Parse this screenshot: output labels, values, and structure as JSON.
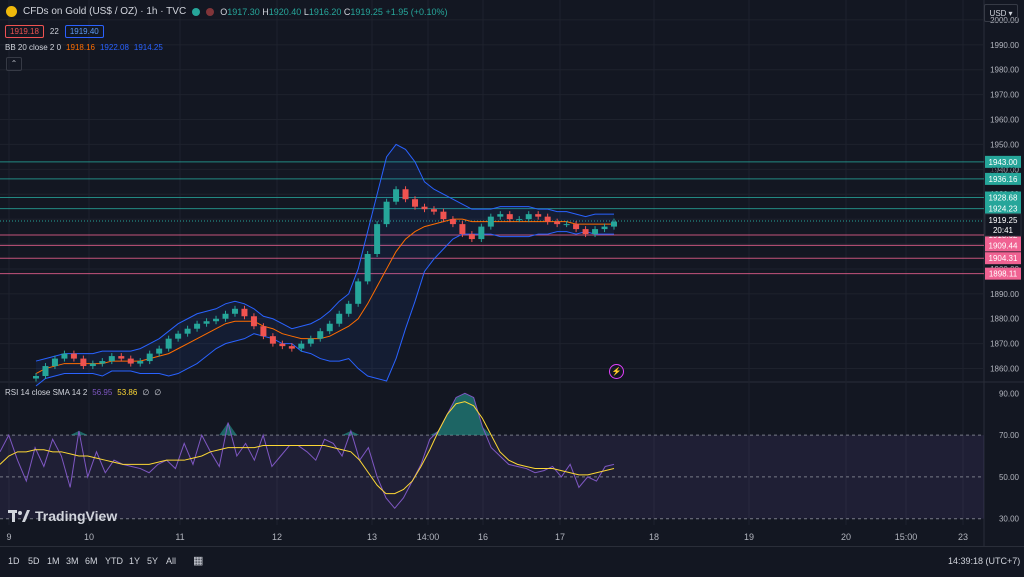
{
  "header": {
    "title": "CFDs on Gold (US$ / OZ) · 1h · TVC",
    "ohlc": {
      "o_label": "O",
      "o": "1917.30",
      "h_label": "H",
      "h": "1920.40",
      "l_label": "L",
      "l": "1916.20",
      "c_label": "C",
      "c": "1919.25",
      "change": "+1.95 (+0.10%)"
    },
    "bid": "1919.18",
    "spread": "22",
    "ask": "1919.40",
    "bb": {
      "label": "BB 20 close 2 0",
      "basis": "1918.16",
      "upper": "1922.08",
      "lower": "1914.25"
    },
    "collapse_icon": "chevron-up-icon"
  },
  "currency": {
    "label": "USD"
  },
  "rsi_legend": {
    "label": "RSI 14 close SMA 14 2",
    "rsi": "56.95",
    "sma": "53.86",
    "e1": "∅",
    "e2": "∅"
  },
  "brand": {
    "name": "TradingView"
  },
  "colors": {
    "bg": "#131722",
    "up": "#26a69a",
    "down": "#ef5350",
    "bb_band": "#2962ff",
    "bb_basis": "#ff6d00",
    "rsi": "#7e57c2",
    "rsi_sma": "#fdd835",
    "green_level": "#26a69a",
    "red_level": "#f06292"
  },
  "toolbar": {
    "timeframes": [
      "1D",
      "5D",
      "1M",
      "3M",
      "6M",
      "YTD",
      "1Y",
      "5Y",
      "All"
    ],
    "calendar_icon": "calendar-icon",
    "clock": "14:39:18 (UTC+7)"
  },
  "chart_data": [
    {
      "type": "candlestick",
      "title": "CFDs on Gold (US$ / OZ)",
      "ylim": [
        1855,
        2008
      ],
      "y_ticks": [
        1860,
        1870,
        1880,
        1890,
        1900,
        1910,
        1920,
        1930,
        1940,
        1950,
        1960,
        1970,
        1980,
        1990,
        2000
      ],
      "x_ticks": [
        "9",
        "10",
        "11",
        "12",
        "13",
        "14:00",
        "16",
        "17",
        "18",
        "19",
        "20",
        "15:00",
        "23"
      ],
      "grid": true,
      "close": [
        1857,
        1861,
        1864,
        1866,
        1864,
        1861,
        1862,
        1863,
        1865,
        1864,
        1862,
        1863,
        1866,
        1868,
        1872,
        1874,
        1876,
        1878,
        1879,
        1880,
        1882,
        1884,
        1881,
        1877,
        1873,
        1870,
        1869,
        1868,
        1870,
        1872,
        1875,
        1878,
        1882,
        1886,
        1895,
        1906,
        1918,
        1927,
        1932,
        1928,
        1925,
        1924,
        1923,
        1920,
        1918,
        1914,
        1912,
        1917,
        1921,
        1922,
        1920,
        1920,
        1922,
        1921,
        1919,
        1918,
        1918,
        1916,
        1914,
        1916,
        1917,
        1919
      ],
      "lines": [
        {
          "name": "BB upper",
          "values": [
            1863,
            1864,
            1865,
            1866,
            1866,
            1866,
            1866,
            1867,
            1867,
            1867,
            1867,
            1868,
            1870,
            1872,
            1875,
            1878,
            1880,
            1882,
            1883,
            1884,
            1886,
            1887,
            1886,
            1884,
            1881,
            1880,
            1878,
            1876,
            1877,
            1878,
            1880,
            1883,
            1887,
            1890,
            1900,
            1915,
            1930,
            1945,
            1950,
            1948,
            1943,
            1935,
            1932,
            1930,
            1928,
            1926,
            1924,
            1924,
            1924,
            1925,
            1925,
            1925,
            1925,
            1924,
            1924,
            1923,
            1923,
            1922,
            1921,
            1922,
            1922,
            1922
          ]
        },
        {
          "name": "BB basis",
          "values": [
            1858,
            1860,
            1861,
            1862,
            1862,
            1862,
            1862,
            1862,
            1863,
            1863,
            1863,
            1863,
            1864,
            1865,
            1866,
            1868,
            1870,
            1872,
            1874,
            1876,
            1878,
            1879,
            1879,
            1879,
            1877,
            1876,
            1874,
            1873,
            1872,
            1872,
            1872,
            1873,
            1875,
            1877,
            1880,
            1886,
            1893,
            1900,
            1907,
            1912,
            1915,
            1917,
            1918,
            1919,
            1920,
            1920,
            1919,
            1919,
            1919,
            1919,
            1919,
            1919,
            1919,
            1919,
            1919,
            1919,
            1919,
            1918,
            1918,
            1918,
            1918,
            1918
          ]
        },
        {
          "name": "BB lower",
          "values": [
            1853,
            1856,
            1857,
            1858,
            1858,
            1858,
            1858,
            1857,
            1859,
            1859,
            1859,
            1858,
            1858,
            1858,
            1857,
            1858,
            1860,
            1862,
            1865,
            1868,
            1870,
            1871,
            1872,
            1874,
            1873,
            1872,
            1870,
            1870,
            1867,
            1866,
            1864,
            1863,
            1863,
            1864,
            1860,
            1857,
            1856,
            1855,
            1864,
            1876,
            1887,
            1899,
            1904,
            1908,
            1912,
            1914,
            1914,
            1914,
            1914,
            1913,
            1913,
            1913,
            1913,
            1914,
            1914,
            1915,
            1915,
            1914,
            1915,
            1914,
            1914,
            1914
          ]
        }
      ],
      "levels": [
        {
          "value": 1943.0,
          "label": "1943.00",
          "kind": "green"
        },
        {
          "value": 1936.16,
          "label": "1936.16",
          "kind": "green"
        },
        {
          "value": 1928.68,
          "label": "1928.68",
          "kind": "green"
        },
        {
          "value": 1924.23,
          "label": "1924.23",
          "kind": "green"
        },
        {
          "value": 1913.62,
          "label": "1913.62",
          "kind": "red"
        },
        {
          "value": 1909.44,
          "label": "1909.44",
          "kind": "red"
        },
        {
          "value": 1904.31,
          "label": "1904.31",
          "kind": "red"
        },
        {
          "value": 1898.11,
          "label": "1898.11",
          "kind": "red"
        }
      ],
      "last_price": {
        "value": 1919.25,
        "label": "1919.25",
        "countdown": "20:41"
      },
      "hidden_label": {
        "value": 1940.0,
        "label": "1940.00"
      }
    },
    {
      "type": "line",
      "title": "RSI 14 close SMA 14 2",
      "ylim": [
        27,
        93
      ],
      "y_ticks": [
        30.0,
        50.0,
        70.0,
        90.0
      ],
      "bands": [
        30,
        50,
        70
      ],
      "series": [
        {
          "name": "RSI",
          "values": [
            62,
            70,
            58,
            48,
            64,
            55,
            68,
            60,
            45,
            72,
            50,
            62,
            52,
            58,
            56,
            55,
            54,
            52,
            56,
            58,
            54,
            66,
            56,
            70,
            62,
            55,
            76,
            60,
            66,
            58,
            70,
            55,
            60,
            65,
            65,
            62,
            58,
            68,
            66,
            60,
            72,
            58,
            64,
            50,
            40,
            35,
            40,
            48,
            56,
            68,
            72,
            80,
            88,
            90,
            88,
            74,
            64,
            60,
            56,
            55,
            54,
            52,
            53,
            55,
            50,
            56,
            45,
            50,
            48,
            55,
            56
          ]
        },
        {
          "name": "SMA",
          "values": [
            56,
            60,
            62,
            62,
            63,
            63,
            62,
            62,
            61,
            60,
            60,
            59,
            58,
            57,
            56,
            56,
            56,
            56,
            57,
            58,
            58,
            58,
            59,
            60,
            62,
            63,
            64,
            64,
            64,
            64,
            65,
            65,
            65,
            65,
            65,
            65,
            65,
            65,
            64,
            63,
            62,
            58,
            52,
            46,
            42,
            42,
            44,
            48,
            55,
            63,
            72,
            80,
            85,
            86,
            84,
            78,
            70,
            62,
            58,
            56,
            55,
            54,
            54,
            54,
            53,
            52,
            51,
            51,
            52,
            53,
            54
          ]
        }
      ]
    }
  ]
}
